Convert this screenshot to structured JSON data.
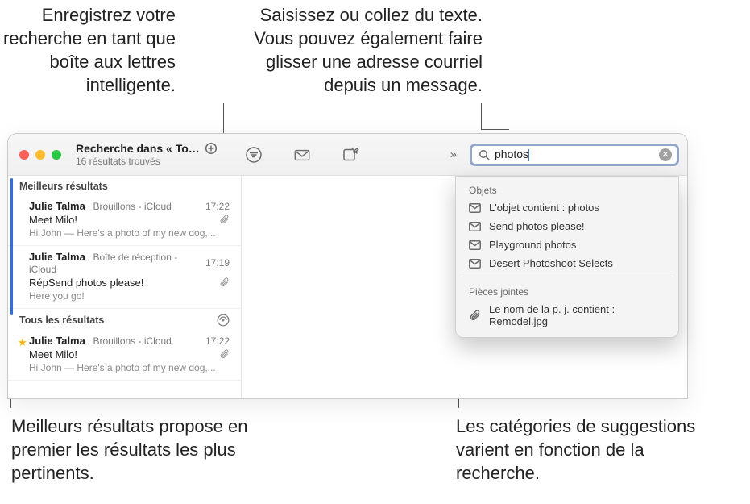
{
  "callouts": {
    "top_left": "Enregistrez votre recherche en tant que boîte aux lettres intelligente.",
    "top_right": "Saisissez ou collez du texte. Vous pouvez également faire glisser une adresse courriel depuis un message.",
    "bottom_left": "Meilleurs résultats propose en premier les résultats les plus pertinents.",
    "bottom_right": "Les catégories de suggestions varient en fonction de la recherche."
  },
  "window": {
    "title": "Recherche dans « Tout...",
    "subtitle": "16 résultats trouvés",
    "search_value": "photos"
  },
  "toolbar_icons": {
    "circle_lines": "filter-icon",
    "envelope": "envelope-icon",
    "compose": "compose-icon"
  },
  "suggestions": {
    "group1_header": "Objets",
    "group1_items": [
      "L'objet contient : photos",
      "Send photos please!",
      "Playground photos",
      "Desert Photoshoot Selects"
    ],
    "group2_header": "Pièces jointes",
    "group2_items": [
      "Le nom de la p. j. contient : Remodel.jpg"
    ]
  },
  "sidebar": {
    "section1_label": "Meilleurs résultats",
    "section2_label": "Tous les résultats",
    "messages_top": [
      {
        "sender": "Julie Talma",
        "mailbox": "Brouillons - iCloud",
        "time": "17:22",
        "subject": "Meet Milo!",
        "preview": "Hi John — Here's a photo of my new dog,..."
      },
      {
        "sender": "Julie Talma",
        "mailbox": "Boîte de réception - iCloud",
        "time": "17:19",
        "subject": "RépSend photos please!",
        "preview": "Here you go!"
      }
    ],
    "messages_all": [
      {
        "sender": "Julie Talma",
        "mailbox": "Brouillons - iCloud",
        "time": "17:22",
        "subject": "Meet Milo!",
        "preview": "Hi John — Here's a photo of my new dog,...",
        "starred": true
      }
    ]
  }
}
